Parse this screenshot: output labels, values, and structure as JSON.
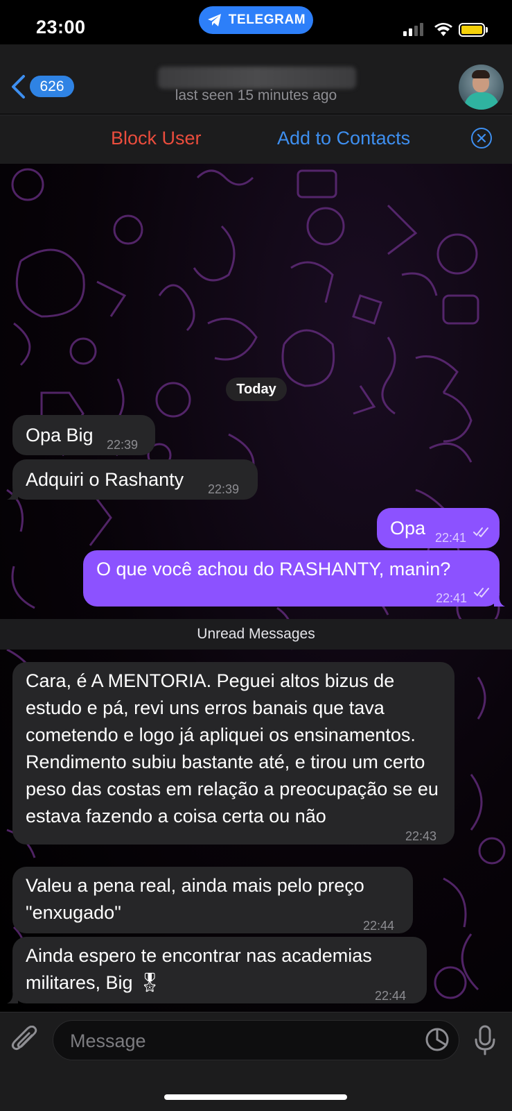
{
  "status_bar": {
    "time": "23:00",
    "app_pill": "TELEGRAM",
    "icons": [
      "signal-icon",
      "wifi-icon",
      "battery-icon"
    ]
  },
  "nav": {
    "back_badge": "626",
    "last_seen": "last seen 15 minutes ago",
    "avatar": "contact-avatar"
  },
  "actions": {
    "block": "Block User",
    "add": "Add to Contacts"
  },
  "chat": {
    "date_separator": "Today",
    "unread_separator": "Unread Messages",
    "messages": [
      {
        "dir": "in",
        "text": "Opa Big",
        "time": "22:39"
      },
      {
        "dir": "in",
        "text": "Adquiri o Rashanty",
        "time": "22:39"
      },
      {
        "dir": "out",
        "text": "Opa",
        "time": "22:41"
      },
      {
        "dir": "out",
        "text": "O que você achou do RASHANTY, manin?",
        "time": "22:41"
      },
      {
        "dir": "in",
        "text": "Cara, é A MENTORIA. Peguei altos bizus de estudo e pá, revi uns erros banais que tava cometendo e logo já apliquei os ensinamentos. Rendimento subiu bastante até, e tirou um certo peso das costas em relação a preocupação se eu estava fazendo a coisa certa ou não",
        "time": "22:43"
      },
      {
        "dir": "in",
        "text": "Valeu a pena real, ainda mais pelo preço \"enxugado\"",
        "time": "22:44"
      },
      {
        "dir": "in",
        "text": "Ainda espero te encontrar nas academias militares, Big 🎖",
        "time": "22:44"
      }
    ]
  },
  "composer": {
    "placeholder": "Message"
  },
  "colors": {
    "accent_blue": "#3e8ff0",
    "block_red": "#eb4d3d",
    "outgoing_bubble": "#8c52ff",
    "incoming_bubble": "#262628"
  }
}
